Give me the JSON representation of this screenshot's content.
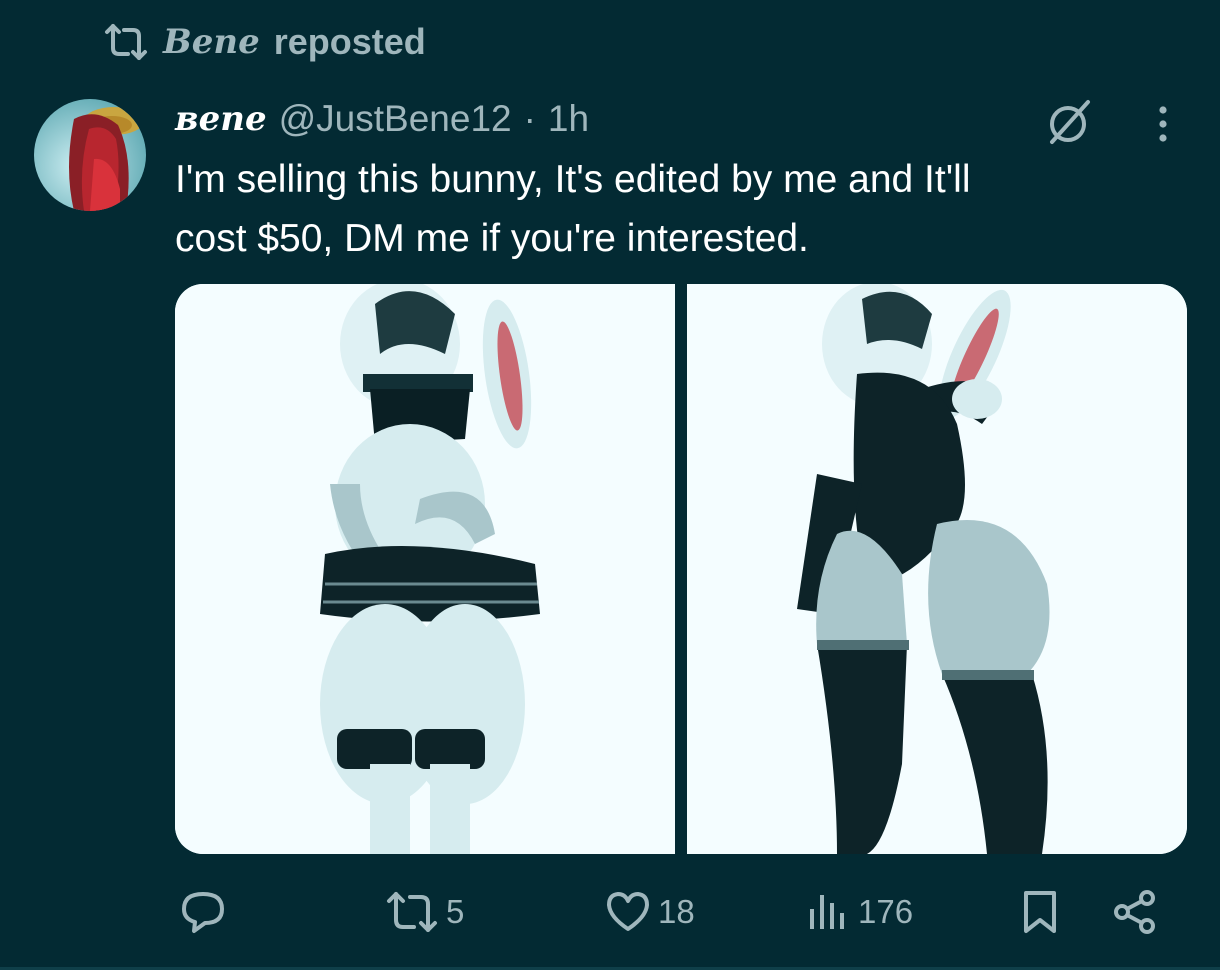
{
  "repost_header": {
    "name": "Bene",
    "text": "reposted",
    "icon": "repost-icon"
  },
  "tweet": {
    "author": {
      "display_name": "ʙene",
      "handle": "@JustBene12",
      "separator": "·",
      "time": "1h",
      "avatar_icon": "avatar"
    },
    "text_lines": [
      "I'm selling this bunny, It's edited by me and It'll",
      "cost $50, DM me if you're interested."
    ],
    "media": [
      {
        "label": "image 1"
      },
      {
        "label": "image 2"
      }
    ],
    "actions": {
      "reply": {
        "icon": "reply-icon",
        "count": ""
      },
      "repost": {
        "icon": "repost-icon",
        "count": "5"
      },
      "like": {
        "icon": "heart-icon",
        "count": "18"
      },
      "views": {
        "icon": "views-icon",
        "count": "176"
      },
      "bookmark": {
        "icon": "bookmark-icon"
      },
      "share": {
        "icon": "share-icon"
      }
    },
    "header_icons": [
      "grok-icon",
      "more-vertical-icon"
    ]
  },
  "colors": {
    "background": "#032a33",
    "primary_text": "#ffffff",
    "secondary_text": "#9fb6bc",
    "media_bg": "#f4fdff"
  }
}
